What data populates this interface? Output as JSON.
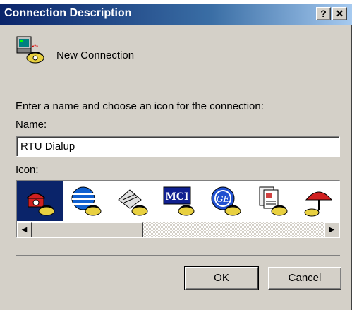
{
  "caption_fragment": "",
  "dialog": {
    "title": "Connection Description",
    "help_label": "?",
    "close_label": "✕"
  },
  "connection": {
    "name_display": "New Connection"
  },
  "form": {
    "instruction": "Enter a name and choose an icon for the connection:",
    "name_label": "Name:",
    "name_value": "RTU Dialup",
    "icon_label": "Icon:"
  },
  "icons": [
    {
      "name": "red-phone-icon",
      "selected": true
    },
    {
      "name": "globe-phone-icon",
      "selected": false
    },
    {
      "name": "fax-phone-icon",
      "selected": false
    },
    {
      "name": "mci-phone-icon",
      "selected": false
    },
    {
      "name": "ge-phone-icon",
      "selected": false
    },
    {
      "name": "documents-phone-icon",
      "selected": false
    },
    {
      "name": "umbrella-phone-icon",
      "selected": false
    }
  ],
  "buttons": {
    "ok": "OK",
    "cancel": "Cancel"
  },
  "colors": {
    "titlebar": "#0a246a",
    "dialog_bg": "#d4d0c8",
    "selection": "#0a246a"
  }
}
